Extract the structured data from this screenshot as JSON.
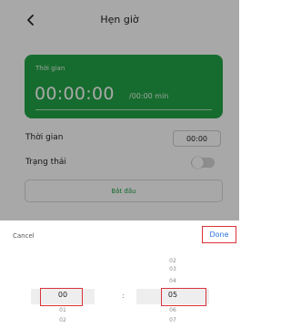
{
  "screen": {
    "title": "Hẹn giờ",
    "back_icon": "chevron-left-icon",
    "timer_card": {
      "label": "Thời gian",
      "time": "00:00:00",
      "time_sub": "/00:00 min",
      "color": "#22a447"
    },
    "rows": {
      "time_label": "Thời gian",
      "time_value": "00:00",
      "status_label": "Trạng thái"
    },
    "toggle_on": false,
    "start_label": "Bắt đầu"
  },
  "picker": {
    "cancel_label": "Cancel",
    "done_label": "Done",
    "separator": ":",
    "hours_above": [],
    "hour_selected": "00",
    "hours_below": [
      "01",
      "02"
    ],
    "minutes_above": [
      "02",
      "03",
      "04"
    ],
    "minute_selected": "05",
    "minutes_below": [
      "06",
      "07"
    ],
    "highlight_color": "#d9333a"
  }
}
